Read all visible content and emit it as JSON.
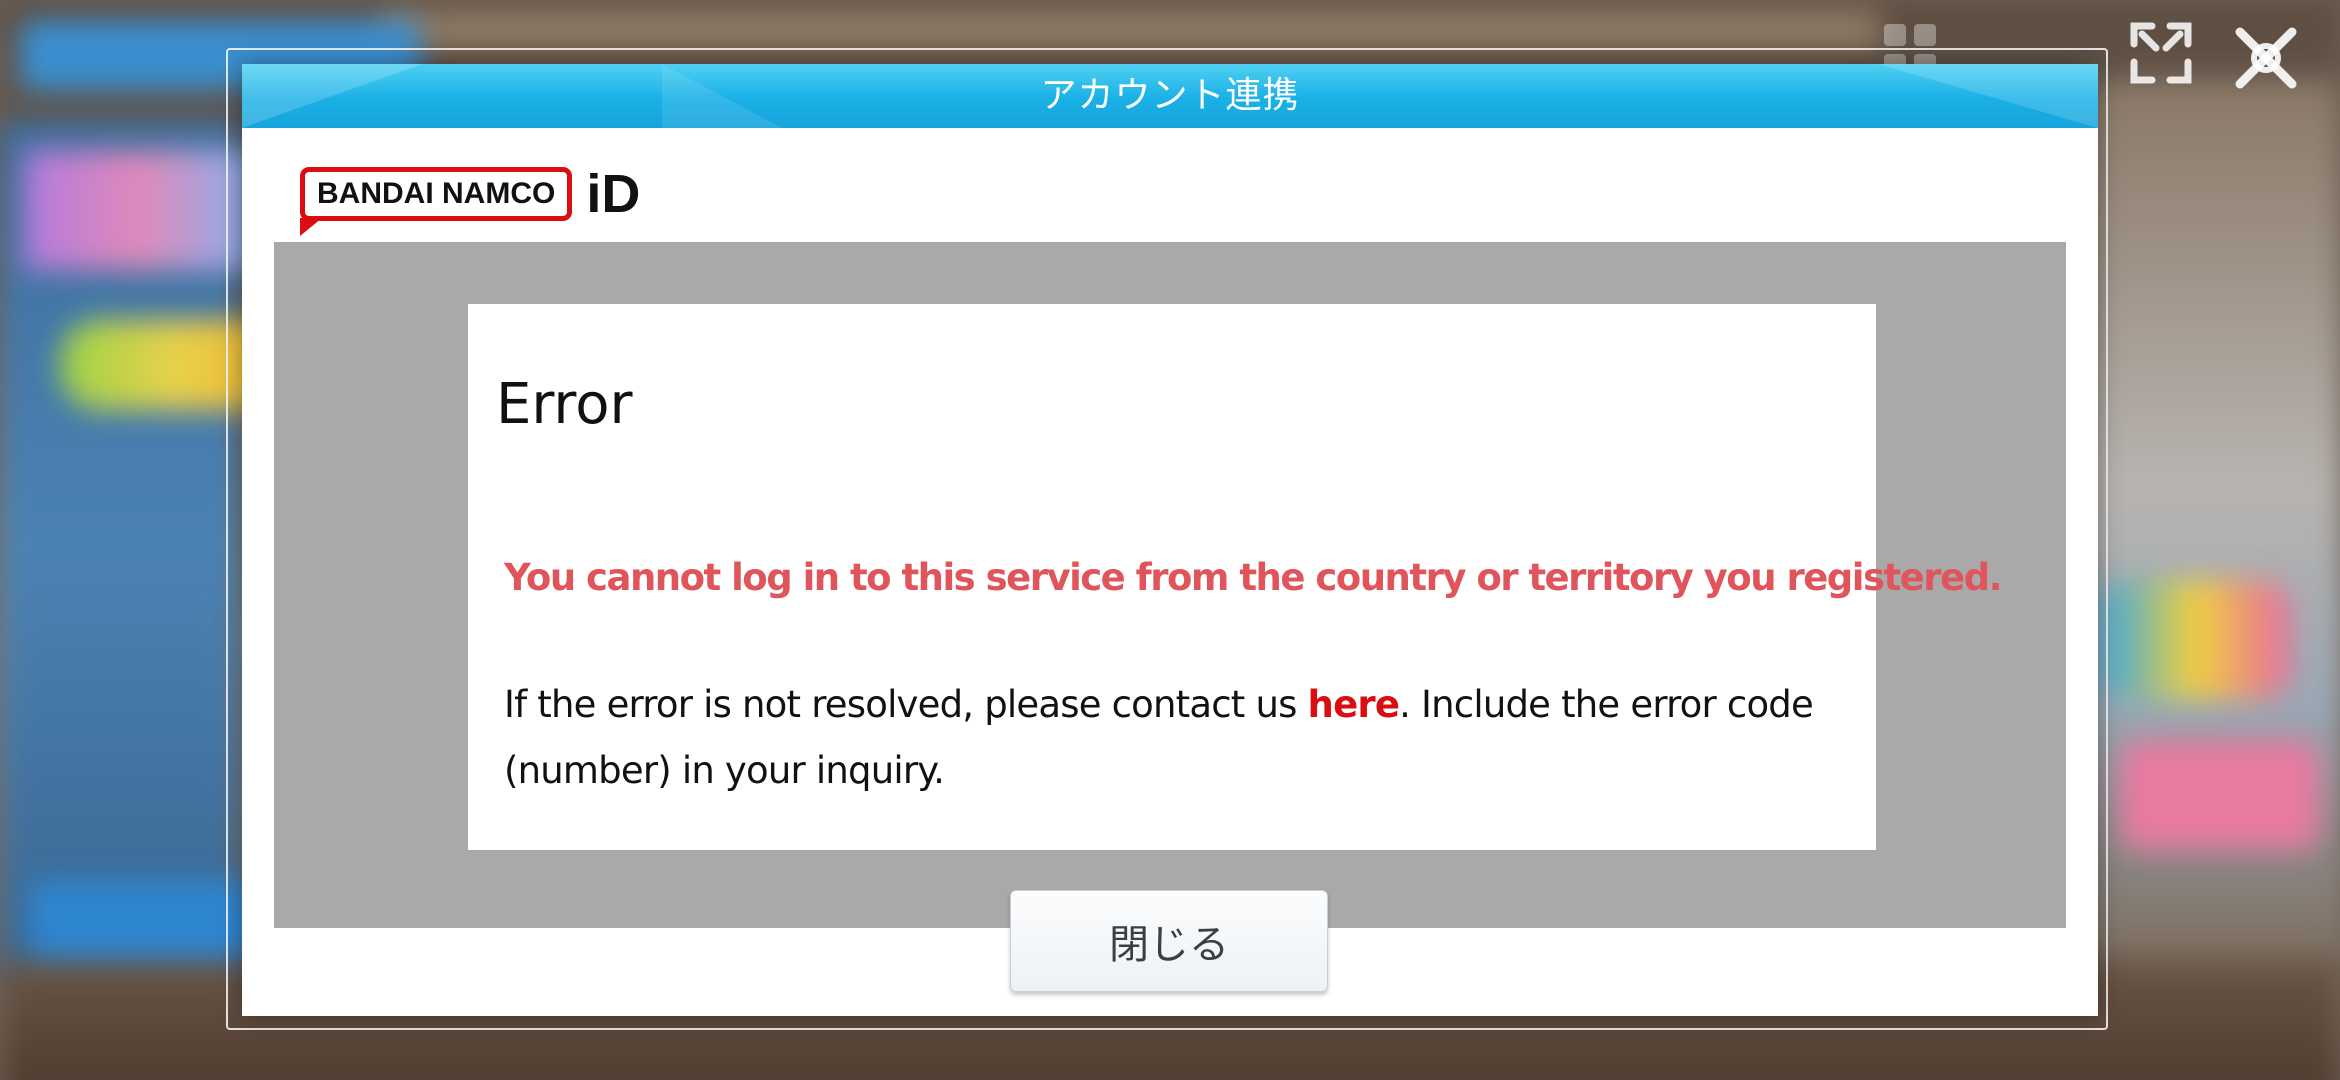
{
  "dialog": {
    "title": "アカウント連携",
    "close_button_label": "閉じる"
  },
  "brand": {
    "name": "BANDAI NAMCO",
    "suffix": "iD",
    "accent_color": "#d90d12"
  },
  "error": {
    "title": "Error",
    "message": "You cannot log in to this service from the country or territory you registered.",
    "help_prefix": "If the error is not resolved, please contact us ",
    "help_link": "here",
    "help_suffix": ". Include the error code (number) in your inquiry.",
    "message_color": "#e0555b"
  },
  "hud": {
    "icons": [
      "menu-grid-icon",
      "expand-icon",
      "close-x-icon"
    ]
  },
  "colors": {
    "header_blue": "#1ab0e6",
    "webview_gray": "#a9a9a9"
  }
}
